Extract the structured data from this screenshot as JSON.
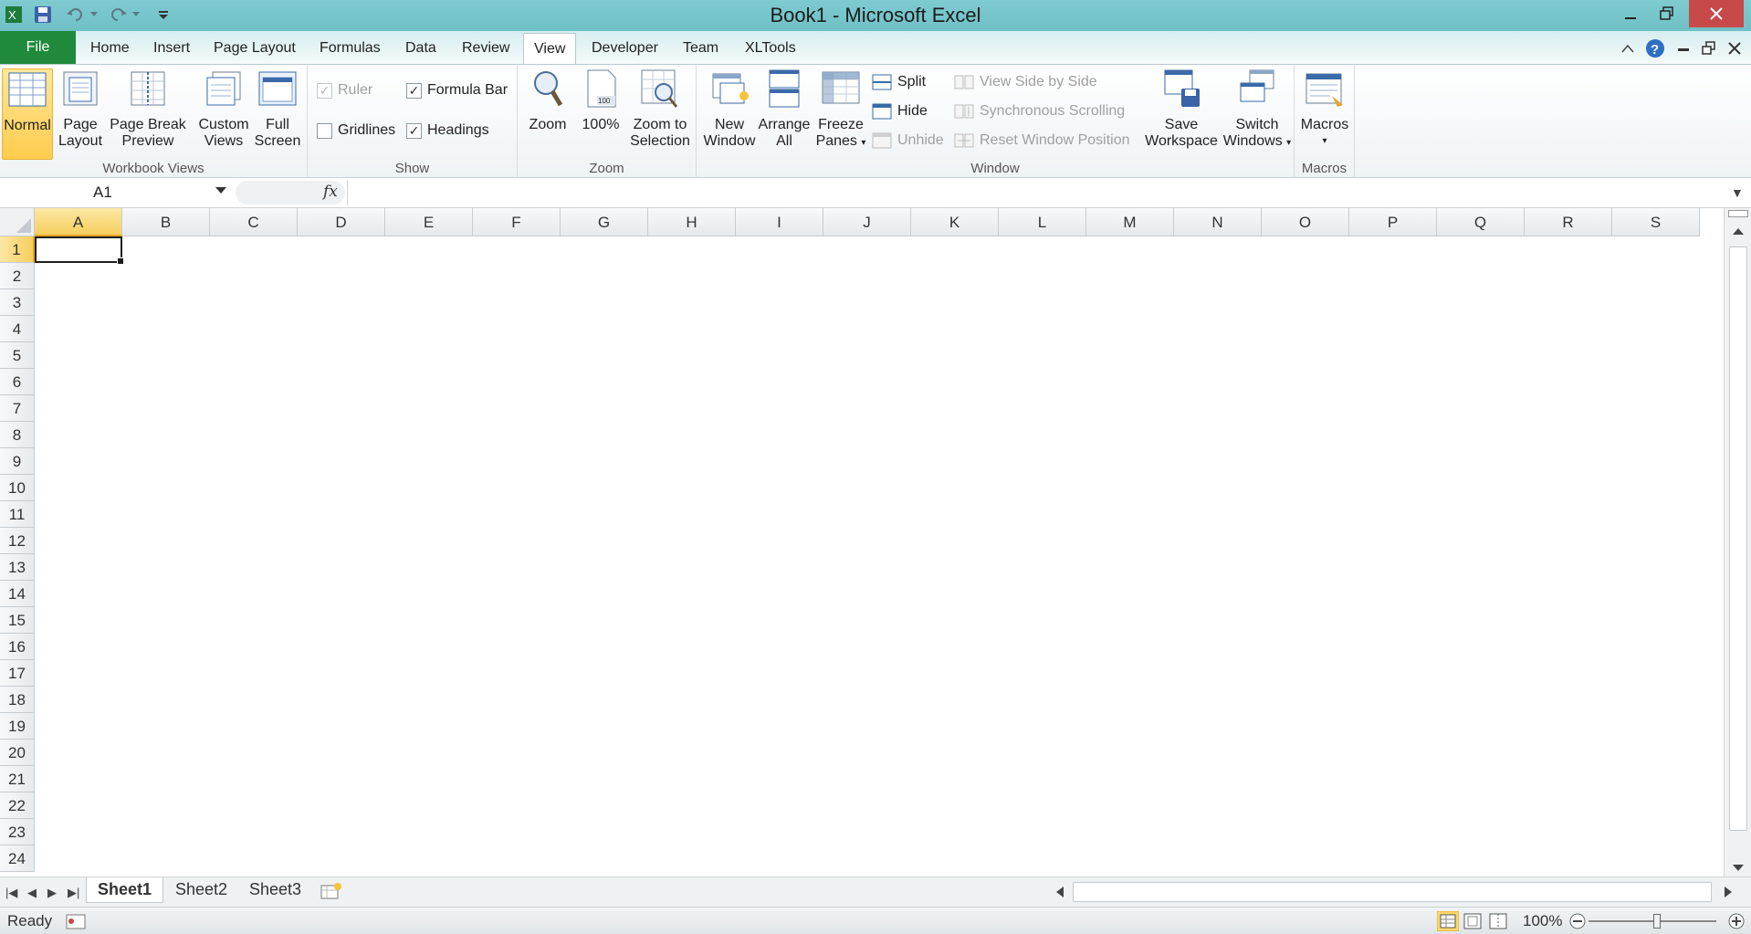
{
  "window": {
    "title": "Book1 - Microsoft Excel"
  },
  "tabs": {
    "file": "File",
    "items": [
      "Home",
      "Insert",
      "Page Layout",
      "Formulas",
      "Data",
      "Review",
      "View",
      "Developer",
      "Team",
      "XLTools"
    ],
    "active": "View"
  },
  "ribbon": {
    "workbook_views": {
      "label": "Workbook Views",
      "normal": "Normal",
      "page_layout_1": "Page",
      "page_layout_2": "Layout",
      "page_break_1": "Page Break",
      "page_break_2": "Preview",
      "custom_views_1": "Custom",
      "custom_views_2": "Views",
      "full_screen_1": "Full",
      "full_screen_2": "Screen"
    },
    "show": {
      "label": "Show",
      "ruler": "Ruler",
      "ruler_checked": "✓",
      "formula_bar": "Formula Bar",
      "formula_bar_checked": "✓",
      "gridlines": "Gridlines",
      "gridlines_checked": "",
      "headings": "Headings",
      "headings_checked": "✓"
    },
    "zoom": {
      "label": "Zoom",
      "zoom": "Zoom",
      "hundred": "100%",
      "zoom_sel_1": "Zoom to",
      "zoom_sel_2": "Selection"
    },
    "window": {
      "label": "Window",
      "new_window_1": "New",
      "new_window_2": "Window",
      "arrange_1": "Arrange",
      "arrange_2": "All",
      "freeze_1": "Freeze",
      "freeze_2": "Panes",
      "split": "Split",
      "hide": "Hide",
      "unhide": "Unhide",
      "side_by_side": "View Side by Side",
      "sync_scroll": "Synchronous Scrolling",
      "reset_pos": "Reset Window Position",
      "save_ws_1": "Save",
      "save_ws_2": "Workspace",
      "switch_1": "Switch",
      "switch_2": "Windows"
    },
    "macros": {
      "label": "Macros",
      "macros": "Macros"
    }
  },
  "formula_bar": {
    "name_box": "A1",
    "fx": "fx",
    "value": ""
  },
  "grid": {
    "columns": [
      "A",
      "B",
      "C",
      "D",
      "E",
      "F",
      "G",
      "H",
      "I",
      "J",
      "K",
      "L",
      "M",
      "N",
      "O",
      "P",
      "Q",
      "R",
      "S"
    ],
    "rows": [
      "1",
      "2",
      "3",
      "4",
      "5",
      "6",
      "7",
      "8",
      "9",
      "10",
      "11",
      "12",
      "13",
      "14",
      "15",
      "16",
      "17",
      "18",
      "19",
      "20",
      "21",
      "22",
      "23",
      "24"
    ],
    "active_cell": "A1"
  },
  "sheets": {
    "tabs": [
      "Sheet1",
      "Sheet2",
      "Sheet3"
    ],
    "active": "Sheet1"
  },
  "status": {
    "text": "Ready",
    "zoom": "100%",
    "zoom_fraction": 0.5
  },
  "colors": {
    "title_bar": "#6fc0c6",
    "file_tab": "#1f8a3b",
    "close_button": "#c7494a",
    "active_header": "#f6cf5d"
  }
}
